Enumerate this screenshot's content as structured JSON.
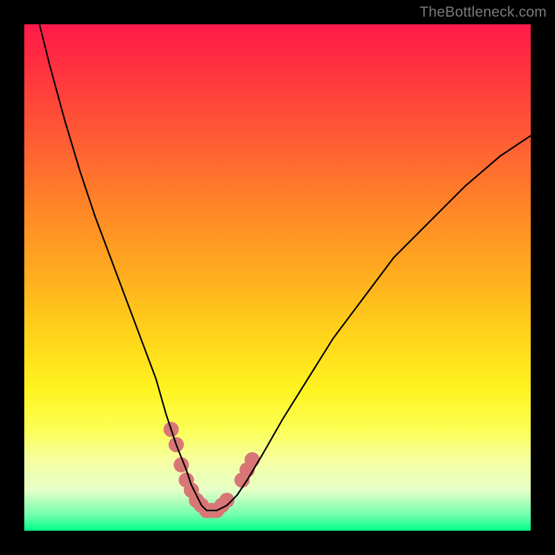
{
  "watermark": "TheBottleneck.com",
  "chart_data": {
    "type": "line",
    "title": "",
    "xlabel": "",
    "ylabel": "",
    "xlim": [
      0,
      100
    ],
    "ylim": [
      0,
      100
    ],
    "grid": false,
    "legend": false,
    "annotations": [],
    "series": [
      {
        "name": "bottleneck-curve",
        "x": [
          3,
          5,
          8,
          11,
          14,
          17,
          20,
          23,
          26,
          28,
          30,
          32,
          33,
          34,
          35,
          36,
          37,
          38,
          40,
          42,
          44,
          47,
          51,
          56,
          61,
          67,
          73,
          80,
          87,
          94,
          100
        ],
        "y": [
          100,
          92,
          81,
          71,
          62,
          54,
          46,
          38,
          30,
          23,
          17,
          12,
          9,
          7,
          5,
          4,
          4,
          4,
          5,
          7,
          10,
          15,
          22,
          30,
          38,
          46,
          54,
          61,
          68,
          74,
          78
        ]
      }
    ],
    "markers": {
      "name": "highlight",
      "color": "#d87676",
      "points": [
        {
          "x": 29,
          "y": 20
        },
        {
          "x": 30,
          "y": 17
        },
        {
          "x": 31,
          "y": 13
        },
        {
          "x": 32,
          "y": 10
        },
        {
          "x": 33,
          "y": 8
        },
        {
          "x": 34,
          "y": 6
        },
        {
          "x": 35,
          "y": 5
        },
        {
          "x": 36,
          "y": 4
        },
        {
          "x": 37,
          "y": 4
        },
        {
          "x": 38,
          "y": 4
        },
        {
          "x": 39,
          "y": 5
        },
        {
          "x": 40,
          "y": 6
        },
        {
          "x": 43,
          "y": 10
        },
        {
          "x": 44,
          "y": 12
        },
        {
          "x": 45,
          "y": 14
        }
      ]
    },
    "background_gradient": {
      "direction": "vertical",
      "stops": [
        {
          "pos": 0.0,
          "color": "#ff1a49"
        },
        {
          "pos": 0.5,
          "color": "#ffae1e"
        },
        {
          "pos": 0.8,
          "color": "#fcff54"
        },
        {
          "pos": 1.0,
          "color": "#00ff88"
        }
      ]
    }
  }
}
